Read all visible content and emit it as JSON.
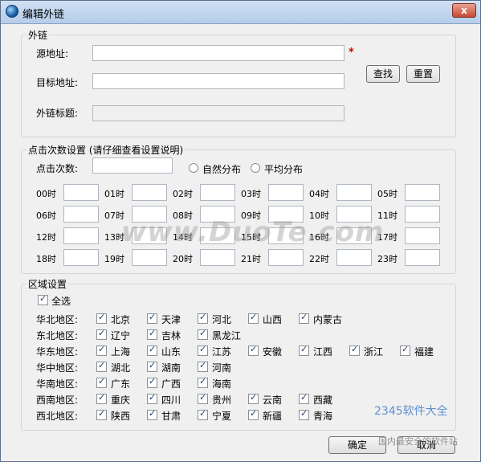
{
  "window": {
    "title": "编辑外链",
    "close_glyph": "x"
  },
  "link_group": {
    "legend": "外链",
    "source_label": "源地址:",
    "source_value": "",
    "required_mark": "*",
    "target_label": "目标地址:",
    "target_value": "",
    "title_label": "外链标题:",
    "title_value": "",
    "find_button": "查找",
    "reset_button": "重置"
  },
  "click_group": {
    "legend": "点击次数设置 (请仔细查看设置说明)",
    "count_label": "点击次数:",
    "count_value": "",
    "radio_natural": "自然分布",
    "radio_average": "平均分布",
    "hours": [
      "00时",
      "01时",
      "02时",
      "03时",
      "04时",
      "05时",
      "06时",
      "07时",
      "08时",
      "09时",
      "10时",
      "11时",
      "12时",
      "13时",
      "14时",
      "15时",
      "16时",
      "17时",
      "18时",
      "19时",
      "20时",
      "21时",
      "22时",
      "23时"
    ]
  },
  "region_group": {
    "legend": "区域设置",
    "select_all": "全选",
    "regions": [
      {
        "label": "华北地区:",
        "provinces": [
          "北京",
          "天津",
          "河北",
          "山西",
          "内蒙古"
        ]
      },
      {
        "label": "东北地区:",
        "provinces": [
          "辽宁",
          "吉林",
          "黑龙江"
        ]
      },
      {
        "label": "华东地区:",
        "provinces": [
          "上海",
          "山东",
          "江苏",
          "安徽",
          "江西",
          "浙江",
          "福建"
        ]
      },
      {
        "label": "华中地区:",
        "provinces": [
          "湖北",
          "湖南",
          "河南"
        ]
      },
      {
        "label": "华南地区:",
        "provinces": [
          "广东",
          "广西",
          "海南"
        ]
      },
      {
        "label": "西南地区:",
        "provinces": [
          "重庆",
          "四川",
          "贵州",
          "云南",
          "西藏"
        ]
      },
      {
        "label": "西北地区:",
        "provinces": [
          "陕西",
          "甘肃",
          "宁夏",
          "新疆",
          "青海"
        ]
      }
    ]
  },
  "footer": {
    "ok_button": "确定",
    "cancel_button": "取消"
  },
  "watermarks": {
    "main": "www.DuoTe.com",
    "brand": "2345软件大全",
    "sub": "国内最安全的软件站"
  }
}
